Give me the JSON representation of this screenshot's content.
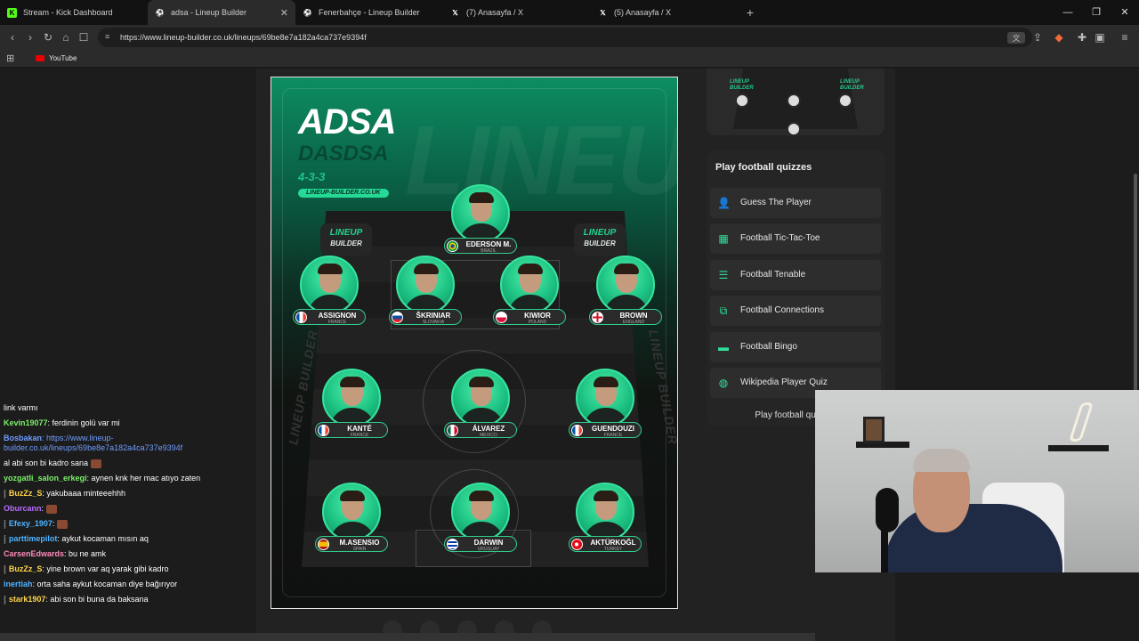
{
  "tabs": [
    {
      "title": "Stream - Kick Dashboard",
      "icon": "kick-icon",
      "active": false
    },
    {
      "title": "adsa - Lineup Builder",
      "icon": "ball-icon",
      "active": true
    },
    {
      "title": "Fenerbahçe - Lineup Builder",
      "icon": "ball-icon",
      "active": false
    },
    {
      "title": "(7) Anasayfa / X",
      "icon": "x-icon",
      "active": false
    },
    {
      "title": "(5) Anasayfa / X",
      "icon": "x-icon",
      "active": false
    }
  ],
  "address": {
    "url": "https://www.lineup-builder.co.uk/lineups/69be8e7a182a4ca737e9394f"
  },
  "bookmarks": [
    {
      "label": "YouTube",
      "icon": "youtube-icon"
    }
  ],
  "lineup": {
    "title": "ADSA",
    "subtitle": "DASDSA",
    "formation": "4-3-3",
    "site": "LINEUP-BUILDER.CO.UK",
    "watermark": "LINEUP",
    "pitch_logo_top": "LINEUP",
    "pitch_logo_bottom": "BUILDER",
    "side_text": "LINEUP BUILDER",
    "players": [
      {
        "name": "EDERSON M.",
        "country": "BRAZIL",
        "flag": "brazil"
      },
      {
        "name": "ASSIGNON",
        "country": "FRANCE",
        "flag": "france"
      },
      {
        "name": "ŠKRINIAR",
        "country": "SLOVAKIA",
        "flag": "slovakia"
      },
      {
        "name": "KIWIOR",
        "country": "POLAND",
        "flag": "poland"
      },
      {
        "name": "BROWN",
        "country": "ENGLAND",
        "flag": "england"
      },
      {
        "name": "KANTÉ",
        "country": "FRANCE",
        "flag": "france"
      },
      {
        "name": "ÁLVAREZ",
        "country": "MEXICO",
        "flag": "mexico"
      },
      {
        "name": "GUENDOUZI",
        "country": "FRANCE",
        "flag": "france"
      },
      {
        "name": "M.ASENSIO",
        "country": "SPAIN",
        "flag": "spain"
      },
      {
        "name": "DARWIN",
        "country": "URUGUAY",
        "flag": "uruguay"
      },
      {
        "name": "AKTÜRKOĞL",
        "country": "TURKEY",
        "flag": "turkey"
      }
    ]
  },
  "right_mini": {
    "logo_top": "LINEUP",
    "logo_bottom": "BUILDER"
  },
  "quizzes": {
    "heading": "Play football quizzes",
    "items": [
      {
        "label": "Guess The Player",
        "icon": "person-icon"
      },
      {
        "label": "Football Tic-Tac-Toe",
        "icon": "grid-icon"
      },
      {
        "label": "Football Tenable",
        "icon": "list-icon"
      },
      {
        "label": "Football Connections",
        "icon": "connections-icon"
      },
      {
        "label": "Football Bingo",
        "icon": "bingo-icon"
      },
      {
        "label": "Wikipedia Player Quiz",
        "icon": "globe-icon"
      }
    ],
    "more": "Play football quizzes"
  },
  "chat": [
    {
      "user": "",
      "text": "link varmı",
      "color": "#ffffff"
    },
    {
      "user": "Kevin19077",
      "text": ": ferdinin golü var mi",
      "color": "#7cf06a"
    },
    {
      "user": "Bosbakan",
      "text": ": https://www.lineup-builder.co.uk/lineups/69be8e7a182a4ca737e9394f",
      "color": "#6f9cff",
      "link": true
    },
    {
      "user": "",
      "text": "al abi son bi kadro sana",
      "color": "#ffffff",
      "emote": true
    },
    {
      "user": "yozgatli_salon_erkegi",
      "text": ": aynen knk her mac atıyo zaten",
      "color": "#7cf06a"
    },
    {
      "user": "BuzZz_S",
      "text": ": yakubaaa minteeehhh",
      "color": "#ffd54a",
      "badge": true
    },
    {
      "user": "Oburcann",
      "text": ":",
      "color": "#b66cff",
      "emote": true
    },
    {
      "user": "Efexy_1907",
      "text": ":",
      "color": "#4fb3ff",
      "badge": true,
      "emote": true
    },
    {
      "user": "parttimepilot",
      "text": ": aykut kocaman mısın aq",
      "color": "#4fb3ff",
      "badge": true
    },
    {
      "user": "CarsenEdwards",
      "text": ": bu ne amk",
      "color": "#ff8ab8"
    },
    {
      "user": "BuzZz_S",
      "text": ": yine brown var aq yarak gibi kadro",
      "color": "#ffd54a",
      "badge": true
    },
    {
      "user": "inertiah",
      "text": ": orta saha aykut kocaman diye bağırıyor",
      "color": "#4fb3ff"
    },
    {
      "user": "stark1907",
      "text": ": abi son bi buna da baksana",
      "color": "#ffd54a",
      "badge": true
    }
  ],
  "colors": {
    "accent": "#22d38d",
    "chat_link": "#6f9cff"
  }
}
